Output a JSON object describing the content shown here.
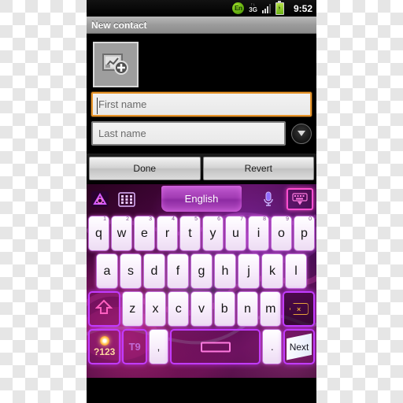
{
  "status_bar": {
    "lang_badge": "En",
    "network": "3G",
    "network_arrows": "↑↓",
    "clock": "9:52",
    "icons": [
      "en-badge-icon",
      "3g-icon",
      "signal-bars-icon",
      "battery-icon"
    ]
  },
  "title_bar": {
    "title": "New contact"
  },
  "contact_form": {
    "photo_placeholder_icon": "add-photo-icon",
    "fields": [
      {
        "name": "first-name",
        "placeholder": "First name",
        "value": "",
        "focused": true
      },
      {
        "name": "last-name",
        "placeholder": "Last name",
        "value": "",
        "focused": false
      }
    ],
    "expand_icon": "chevron-down-icon"
  },
  "action_bar": {
    "buttons": [
      {
        "name": "done-button",
        "label": "Done"
      },
      {
        "name": "revert-button",
        "label": "Revert"
      }
    ]
  },
  "keyboard": {
    "toolbar": {
      "logo_icon": "app-logo-icon",
      "numpad_icon": "numeric-keypad-icon",
      "language_label": "English",
      "mic_icon": "microphone-icon",
      "hide_keyboard_icon": "hide-keyboard-icon"
    },
    "rows": [
      {
        "name": "row-qwerty",
        "keys": [
          {
            "label": "q",
            "sup": "1"
          },
          {
            "label": "w",
            "sup": "2"
          },
          {
            "label": "e",
            "sup": "3"
          },
          {
            "label": "r",
            "sup": "4"
          },
          {
            "label": "t",
            "sup": "5"
          },
          {
            "label": "y",
            "sup": "6"
          },
          {
            "label": "u",
            "sup": "7"
          },
          {
            "label": "i",
            "sup": "8"
          },
          {
            "label": "o",
            "sup": "9"
          },
          {
            "label": "p",
            "sup": "0"
          }
        ]
      },
      {
        "name": "row-asdf",
        "keys": [
          {
            "label": "a"
          },
          {
            "label": "s"
          },
          {
            "label": "d"
          },
          {
            "label": "f"
          },
          {
            "label": "g"
          },
          {
            "label": "h"
          },
          {
            "label": "j"
          },
          {
            "label": "k"
          },
          {
            "label": "l"
          }
        ]
      },
      {
        "name": "row-zxcv",
        "shift_icon": "shift-up-arrow-icon",
        "keys": [
          {
            "label": "z"
          },
          {
            "label": "x"
          },
          {
            "label": "c"
          },
          {
            "label": "v"
          },
          {
            "label": "b"
          },
          {
            "label": "n"
          },
          {
            "label": "m"
          }
        ],
        "backspace_icon": "backspace-icon"
      },
      {
        "name": "row-bottom",
        "symbols_label": "?123",
        "symbols_icon": "settings-flower-icon",
        "t9_label": "T9",
        "comma_label": ",",
        "space_label": "",
        "period_label": ".",
        "next_label": "Next"
      }
    ]
  }
}
